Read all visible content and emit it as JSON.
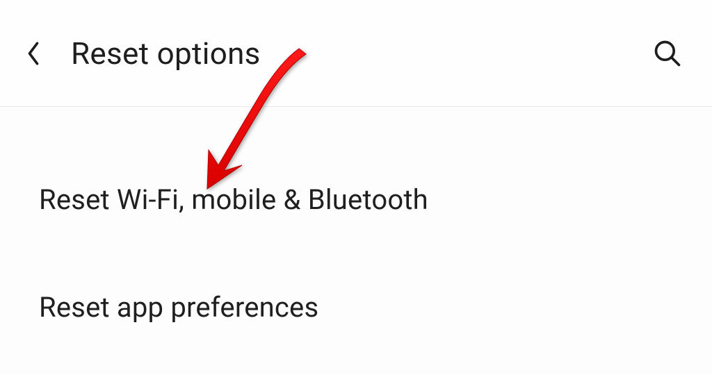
{
  "header": {
    "title": "Reset options"
  },
  "options": {
    "item0": "Reset Wi-Fi, mobile & Bluetooth",
    "item1": "Reset app preferences"
  },
  "annotation": {
    "color": "#ff0008"
  }
}
